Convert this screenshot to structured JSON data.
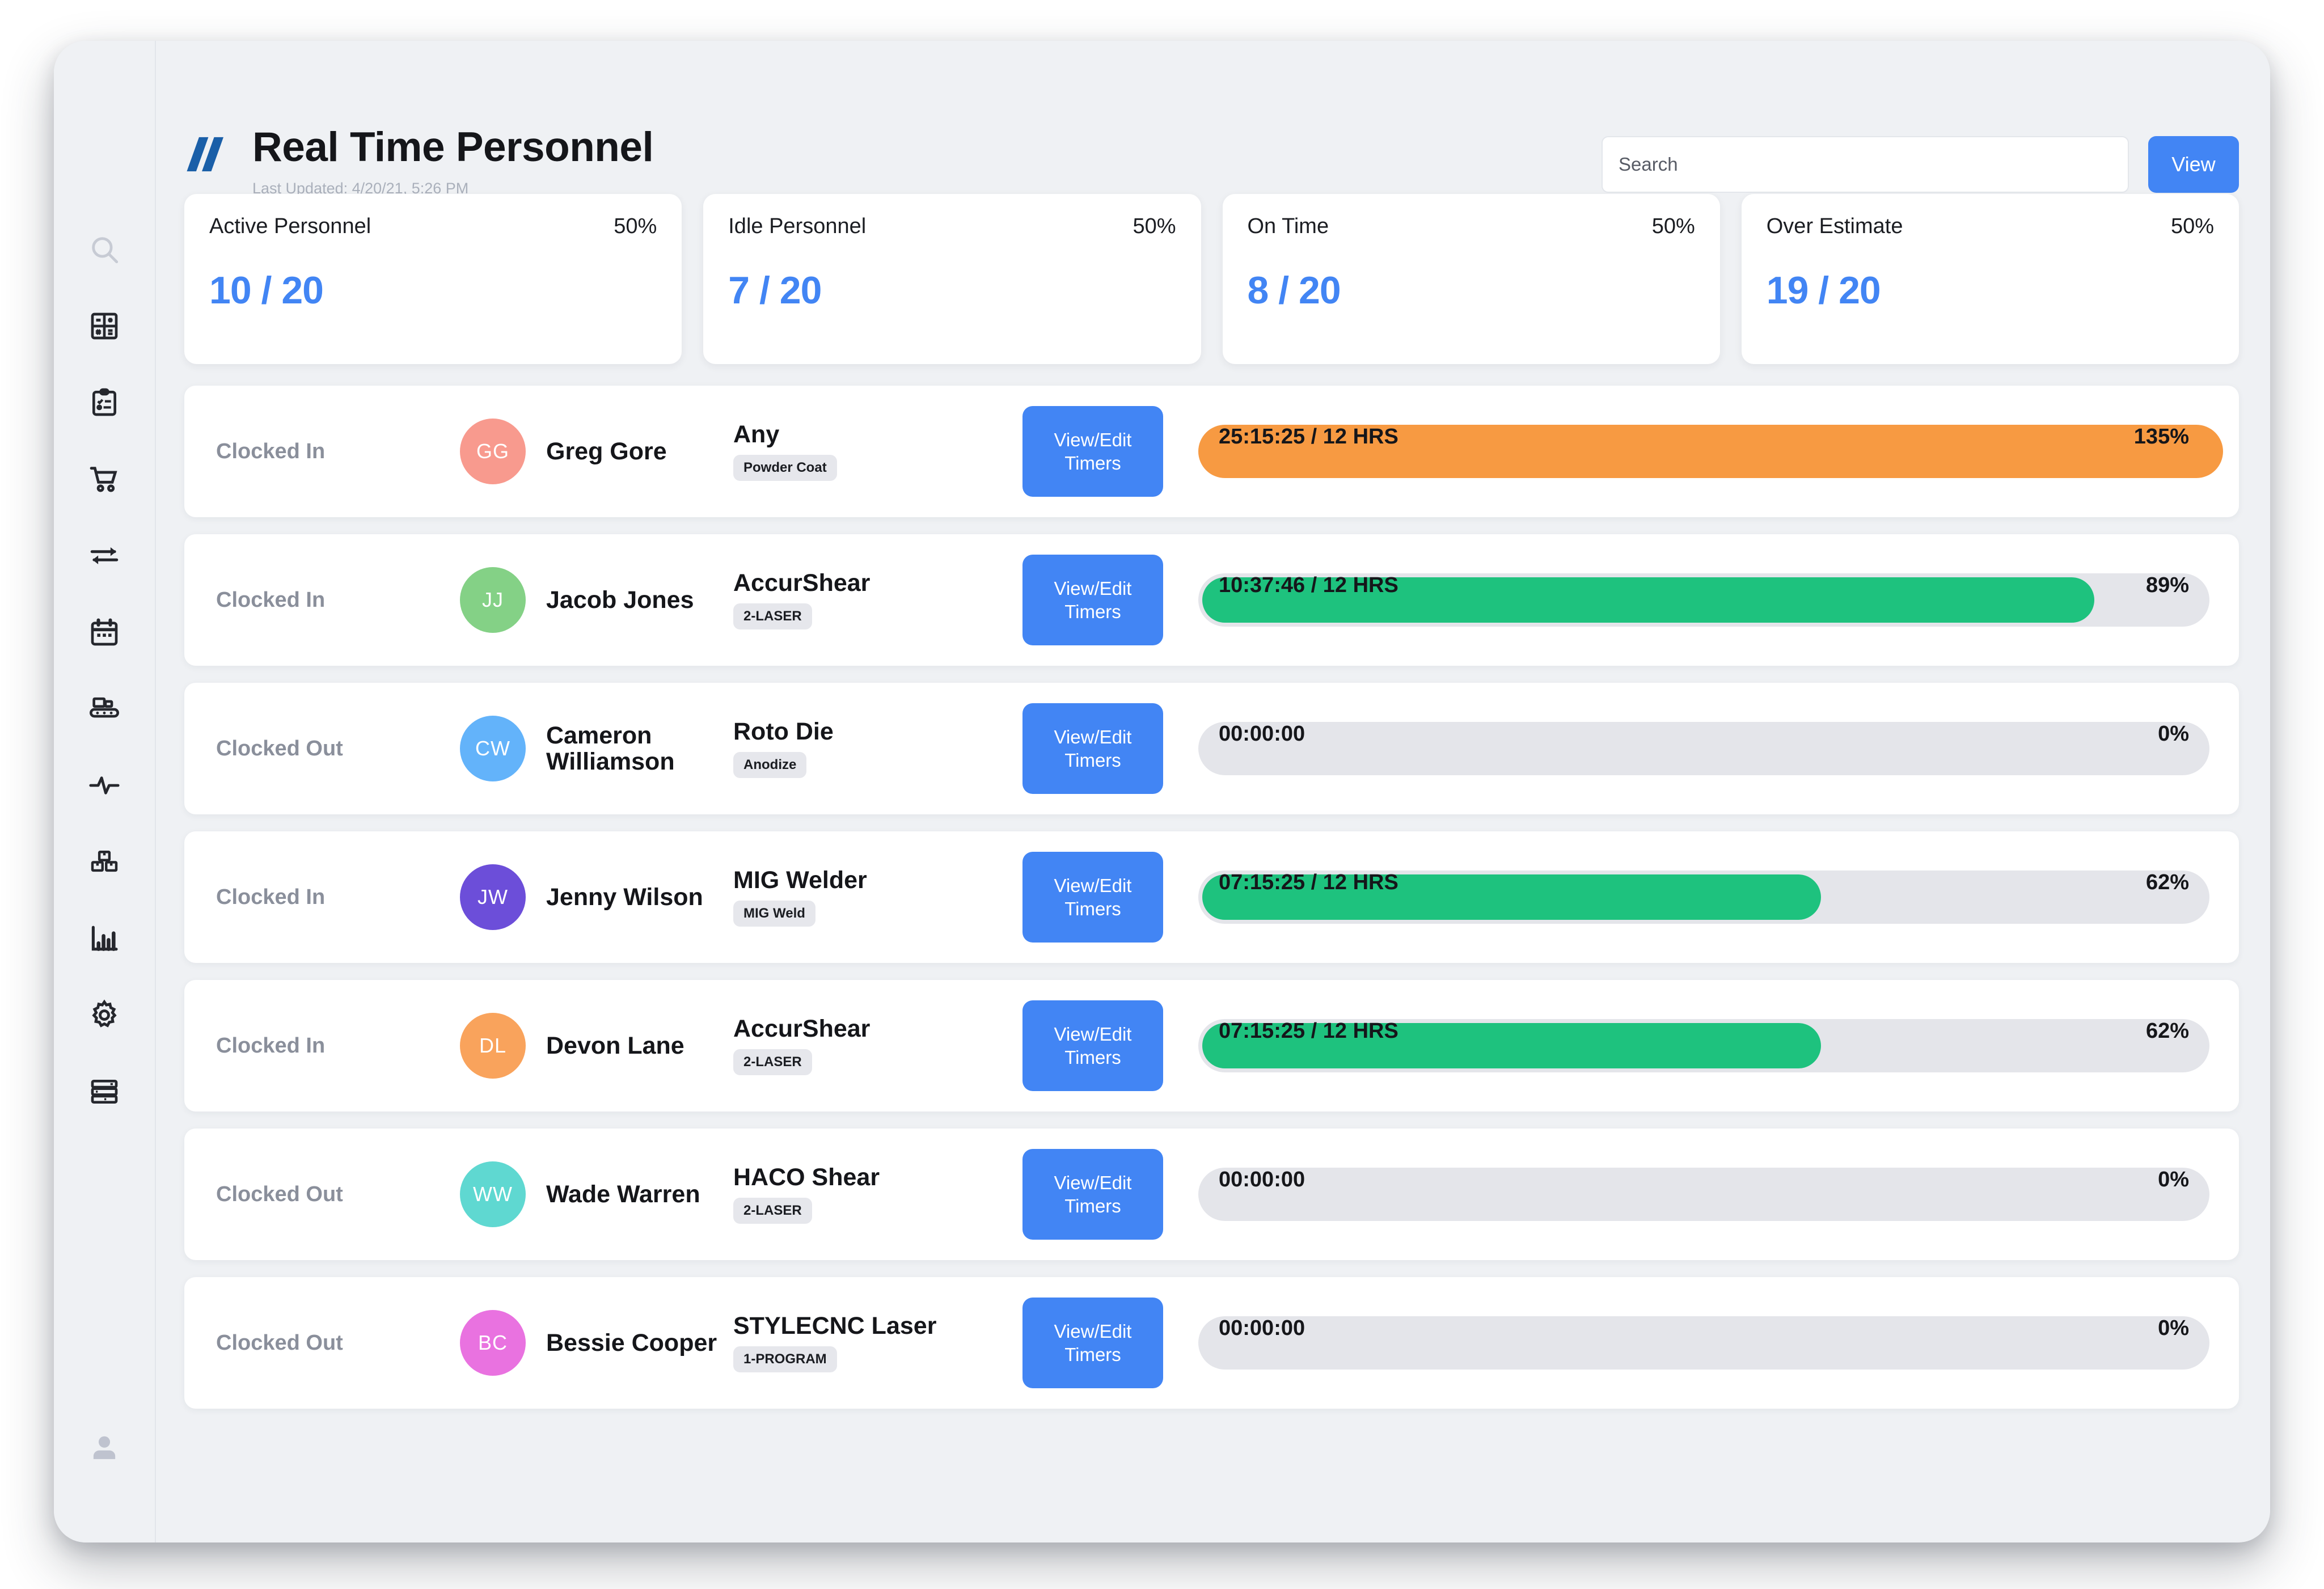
{
  "header": {
    "title": "Real Time Personnel",
    "last_updated": "Last Updated: 4/20/21, 5:26 PM",
    "logo": "double-slash-logo",
    "logo_color": "#1a5fa8",
    "search_placeholder": "Search",
    "search_value": "",
    "view_label": "View",
    "accent_color": "#4285f4"
  },
  "sidebar": {
    "items": [
      {
        "icon": "search-icon"
      },
      {
        "icon": "calculator-icon"
      },
      {
        "icon": "clipboard-checklist-icon"
      },
      {
        "icon": "shopping-cart-icon"
      },
      {
        "icon": "transfer-arrows-icon"
      },
      {
        "icon": "calendar-icon"
      },
      {
        "icon": "conveyor-belt-icon"
      },
      {
        "icon": "activity-pulse-icon"
      },
      {
        "icon": "boxes-inventory-icon"
      },
      {
        "icon": "bar-chart-icon"
      },
      {
        "icon": "gear-icon"
      },
      {
        "icon": "server-stack-icon"
      }
    ],
    "user_icon": "user-avatar-icon"
  },
  "stat_cards": [
    {
      "label": "Active Personnel",
      "percent": "50%",
      "value": "10 / 20"
    },
    {
      "label": "Idle Personnel",
      "percent": "50%",
      "value": "7 / 20"
    },
    {
      "label": "On Time",
      "percent": "50%",
      "value": "8 / 20"
    },
    {
      "label": "Over Estimate",
      "percent": "50%",
      "value": "19 / 20"
    }
  ],
  "rows_common": {
    "timers_label_line1": "View/Edit",
    "timers_label_line2": "Timers"
  },
  "rows": [
    {
      "status": "Clocked In",
      "initials": "GG",
      "avatar_color": "#f89a8e",
      "name": "Greg Gore",
      "machine": "Any",
      "tag": "Powder Coat",
      "time": "25:15:25 / 12 HRS",
      "percent": "135%",
      "percent_value": 135,
      "bar_color": "#f79a42"
    },
    {
      "status": "Clocked In",
      "initials": "JJ",
      "avatar_color": "#84d186",
      "name": "Jacob Jones",
      "machine": "AccurShear",
      "tag": "2-LASER",
      "time": "10:37:46 / 12 HRS",
      "percent": "89%",
      "percent_value": 89,
      "bar_color": "#1ec27e"
    },
    {
      "status": "Clocked Out",
      "initials": "CW",
      "avatar_color": "#63b3fa",
      "name": "Cameron Williamson",
      "machine": "Roto Die",
      "tag": "Anodize",
      "time": "00:00:00",
      "percent": "0%",
      "percent_value": 0,
      "bar_color": "#e4e5ea"
    },
    {
      "status": "Clocked In",
      "initials": "JW",
      "avatar_color": "#6c4ed9",
      "name": "Jenny Wilson",
      "machine": "MIG Welder",
      "tag": "MIG Weld",
      "time": "07:15:25 / 12 HRS",
      "percent": "62%",
      "percent_value": 62,
      "bar_color": "#1ec27e"
    },
    {
      "status": "Clocked In",
      "initials": "DL",
      "avatar_color": "#f9a35c",
      "name": "Devon Lane",
      "machine": "AccurShear",
      "tag": "2-LASER",
      "time": "07:15:25 / 12 HRS",
      "percent": "62%",
      "percent_value": 62,
      "bar_color": "#1ec27e"
    },
    {
      "status": "Clocked Out",
      "initials": "WW",
      "avatar_color": "#5fd8d1",
      "name": "Wade Warren",
      "machine": "HACO Shear",
      "tag": "2-LASER",
      "time": "00:00:00",
      "percent": "0%",
      "percent_value": 0,
      "bar_color": "#e4e5ea"
    },
    {
      "status": "Clocked Out",
      "initials": "BC",
      "avatar_color": "#e972e0",
      "name": "Bessie Cooper",
      "machine": "STYLECNC Laser",
      "tag": "1-PROGRAM",
      "time": "00:00:00",
      "percent": "0%",
      "percent_value": 0,
      "bar_color": "#e4e5ea"
    }
  ]
}
